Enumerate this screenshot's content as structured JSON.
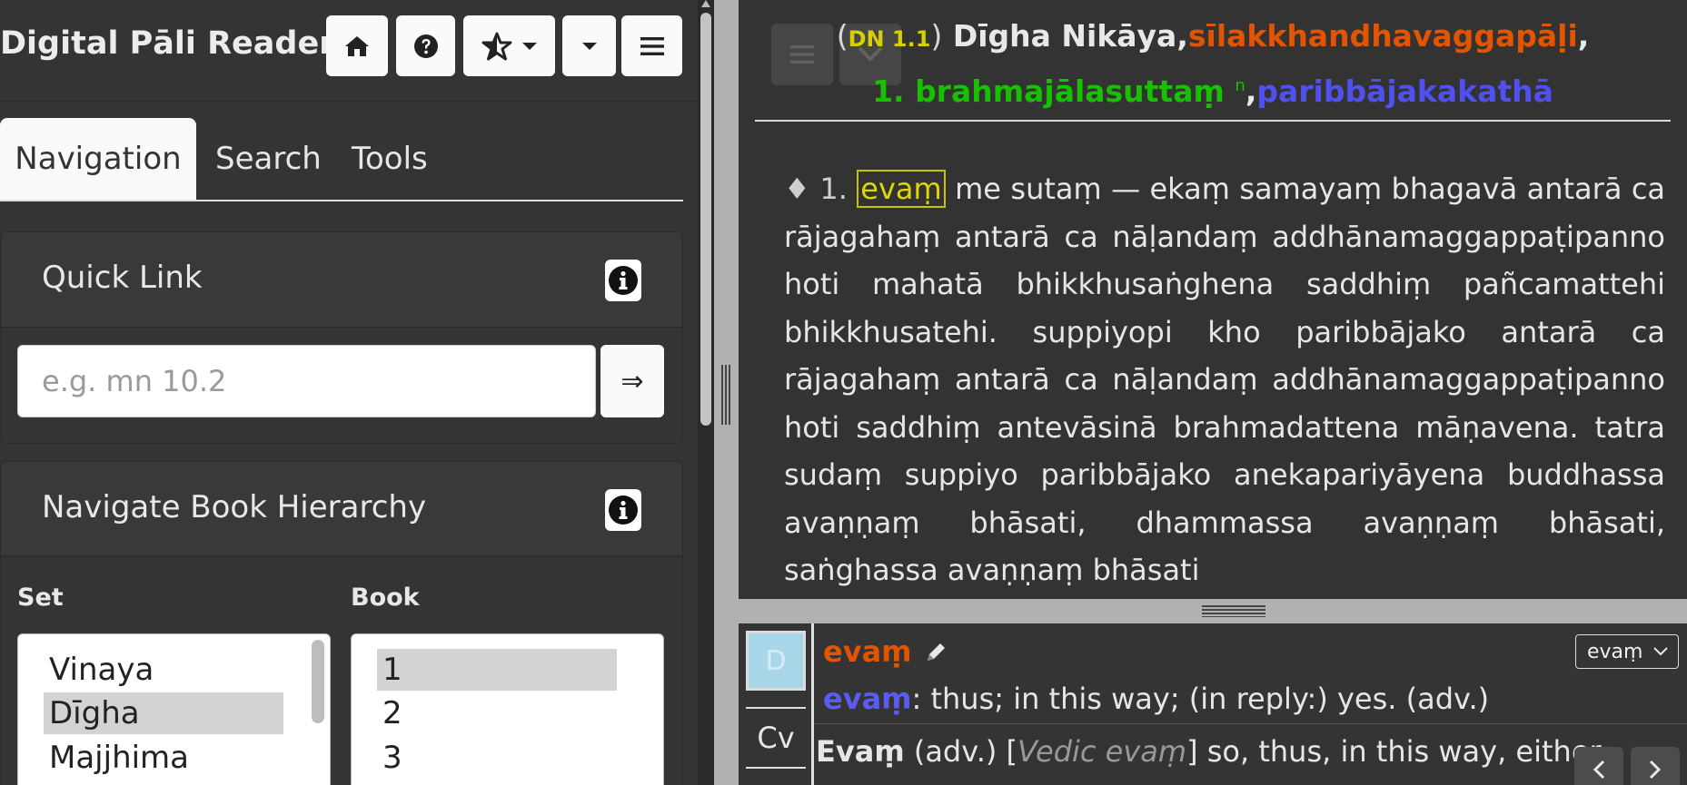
{
  "app": {
    "title": "Digital Pāli Reader"
  },
  "tabs": [
    {
      "label": "Navigation"
    },
    {
      "label": "Search"
    },
    {
      "label": "Tools"
    }
  ],
  "quick_link": {
    "title": "Quick Link",
    "placeholder": "e.g. mn 10.2",
    "go_label": "⇒"
  },
  "hierarchy": {
    "title": "Navigate Book Hierarchy",
    "set_label": "Set",
    "book_label": "Book",
    "sets": [
      "Vinaya",
      "Dīgha",
      "Majjhima"
    ],
    "selected_set": "Dīgha",
    "books": [
      "1",
      "2",
      "3"
    ],
    "selected_book": "1"
  },
  "reader": {
    "heading": {
      "open_paren": "(",
      "ref": "DN 1.1",
      "close_paren": ")",
      "book": "Dīgha Nikāya",
      "sep1": ",",
      "vagga": "sīlakkhandhavaggapāḷi",
      "sep2": ",",
      "sutta": "1. brahmajālasuttaṃ",
      "note_marker": "n",
      "sep3": ",",
      "section": "paribbājakakathā"
    },
    "colors": {
      "ref": "#d6d000",
      "vagga": "#e25400",
      "sutta": "#17c000",
      "section": "#5050ee"
    },
    "para_marker": "♦ 1.",
    "highlight_word": "evaṃ",
    "para_rest": "me sutaṃ — ekaṃ samayaṃ bhagavā antarā ca rājagahaṃ antarā ca nāḷandaṃ addhānamaggappaṭipanno hoti mahatā bhikkhusaṅghena saddhiṃ pañcamattehi bhikkhusatehi. suppiyopi kho paribbājako antarā ca rājagahaṃ antarā ca nāḷandaṃ addhānamaggappaṭipanno hoti saddhiṃ antevāsinā brahmadattena māṇavena. tatra sudaṃ suppiyo paribbājako anekapariyāyena buddhassa avaṇṇaṃ bhāsati, dhammassa avaṇṇaṃ bhāsati, saṅghassa avaṇṇaṃ bhāsati"
  },
  "dictionary": {
    "tab_d": "D",
    "tab_cv": "Cv",
    "word": "evaṃ",
    "select_value": "evaṃ",
    "entry_word": "evaṃ",
    "entry_def": ": thus; in this way; (in reply:) yes. (adv.)",
    "cv_word": "Evaṃ",
    "cv_pos": " (adv.) [",
    "cv_ital": "Vedic evaṃ",
    "cv_rest": "] so, thus, in this way, either"
  }
}
